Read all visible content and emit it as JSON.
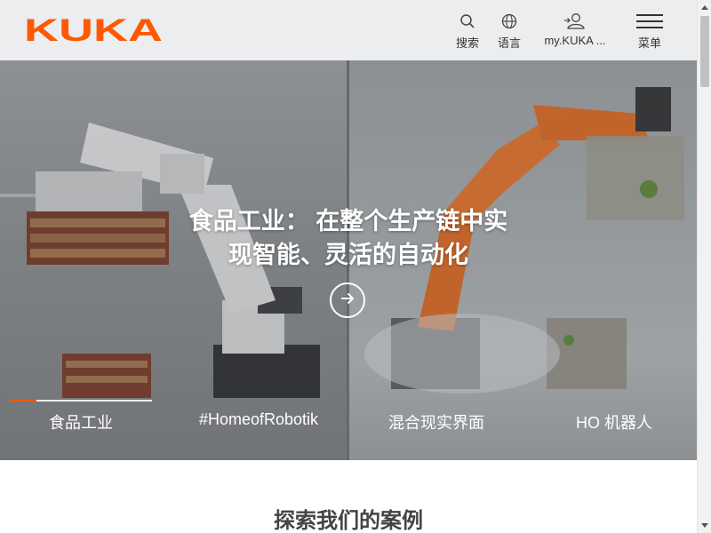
{
  "brand": {
    "logo_text": "KUKA",
    "color": "#ff5800"
  },
  "header": {
    "search": {
      "label": "搜索",
      "icon": "search-icon"
    },
    "language": {
      "label": "语言",
      "icon": "globe-icon"
    },
    "account": {
      "label": "my.KUKA ...",
      "icon": "user-icon"
    },
    "menu": {
      "label": "菜单",
      "icon": "hamburger-icon"
    }
  },
  "hero": {
    "title_line1": "食品工业： 在整个生产链中实",
    "title_line2": "现智能、灵活的自动化",
    "cta_icon": "arrow-right-circle-icon",
    "tabs": [
      {
        "label": "食品工业",
        "active": true
      },
      {
        "label": "#HomeofRobotik",
        "active": false
      },
      {
        "label": "混合现实界面",
        "active": false
      },
      {
        "label": "HO 机器人",
        "active": false
      }
    ],
    "active_indicator_color": "#ff5800"
  },
  "section": {
    "title": "探索我们的案例"
  },
  "scrollbar": {
    "up_icon": "scroll-up-arrow-icon",
    "down_icon": "scroll-down-arrow-icon"
  }
}
